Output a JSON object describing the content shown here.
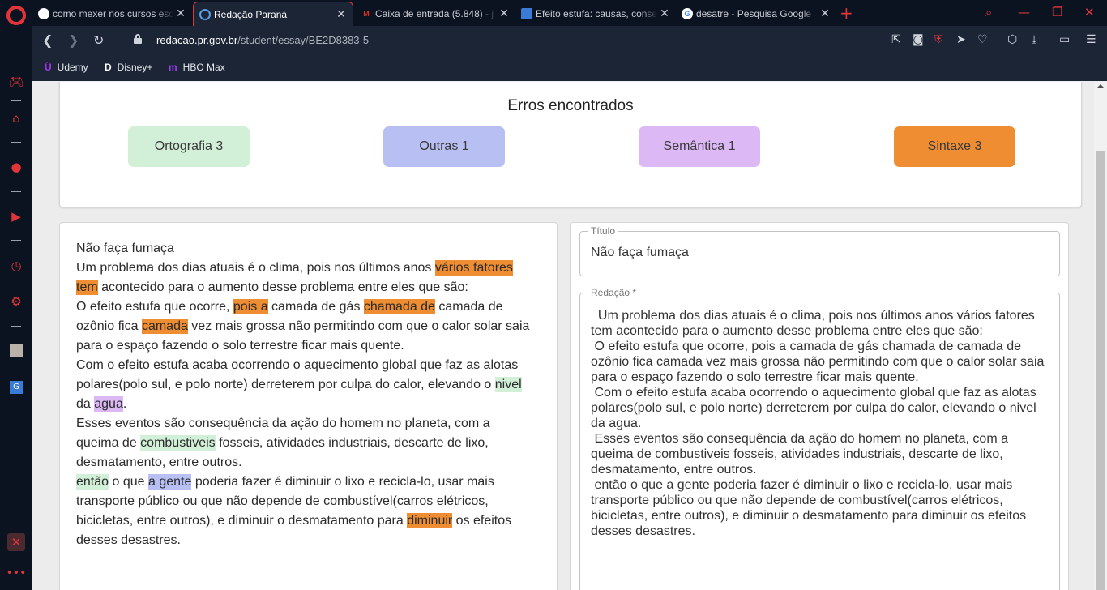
{
  "browser": {
    "tabs": [
      {
        "label": "como mexer nos cursos esc",
        "favicon": "c",
        "favicon_color": "#ffffff",
        "active": false
      },
      {
        "label": "Redação Paraná",
        "favicon": "chat-bubble",
        "favicon_color": "#5aa0e6",
        "active": true
      },
      {
        "label": "Caixa de entrada (5.848) - j",
        "favicon": "M",
        "favicon_color": "#d93025",
        "active": false
      },
      {
        "label": "Efeito estufa: causas, conse",
        "favicon": "earth",
        "favicon_color": "#3a7bd5",
        "active": false
      },
      {
        "label": "desatre - Pesquisa Google",
        "favicon": "G",
        "favicon_color": "#4285f4",
        "active": false
      }
    ],
    "url_domain": "redacao.pr.gov.br",
    "url_path": "/student/essay/BE2D8383-5",
    "bookmarks": [
      {
        "label": "Udemy",
        "icon": "udemy-icon",
        "color": "#a435f0"
      },
      {
        "label": "Disney+",
        "icon": "disney-icon",
        "color": "#ffffff"
      },
      {
        "label": "HBO Max",
        "icon": "hbo-max-icon",
        "color": "#9b41f5"
      }
    ],
    "accent": "#e2353a"
  },
  "errors": {
    "title": "Erros encontrados",
    "chips": [
      {
        "label": "Ortografia 3",
        "color": "#d2f0d8"
      },
      {
        "label": "Outras 1",
        "color": "#b8bff3"
      },
      {
        "label": "Semântica 1",
        "color": "#dcb8f5"
      },
      {
        "label": "Sintaxe 3",
        "color": "#ef8d33"
      }
    ]
  },
  "essay_view": {
    "paragraphs": [
      [
        {
          "t": "Não faça fumaça"
        }
      ],
      [
        {
          "t": "Um problema dos dias atuais é o clima, pois nos últimos anos "
        },
        {
          "t": "vários fatores tem",
          "hl": "orange"
        },
        {
          "t": " acontecido para o aumento desse problema entre eles que são:"
        }
      ],
      [
        {
          "t": "O efeito estufa que ocorre, "
        },
        {
          "t": "pois a",
          "hl": "orange"
        },
        {
          "t": " camada de gás "
        },
        {
          "t": "chamada de",
          "hl": "orange"
        },
        {
          "t": " camada de ozônio fica "
        },
        {
          "t": "camada",
          "hl": "orange"
        },
        {
          "t": " vez mais grossa não permitindo com que o calor solar saia para o espaço fazendo o solo terrestre ficar mais quente."
        }
      ],
      [
        {
          "t": "Com o efeito estufa acaba ocorrendo o aquecimento global que faz as alotas polares(polo sul, e polo norte) derreterem por culpa do calor, elevando o "
        },
        {
          "t": "nivel",
          "hl": "green"
        },
        {
          "t": " da "
        },
        {
          "t": "agua",
          "hl": "purple"
        },
        {
          "t": "."
        }
      ],
      [
        {
          "t": "Esses eventos são consequência da ação do homem no planeta, com a queima de "
        },
        {
          "t": "combustiveis",
          "hl": "green"
        },
        {
          "t": " fosseis, atividades industriais, descarte de lixo, desmatamento, entre outros."
        }
      ],
      [
        {
          "t": "então",
          "hl": "green"
        },
        {
          "t": " o que "
        },
        {
          "t": "a gente",
          "hl": "blue"
        },
        {
          "t": " poderia fazer é diminuir o lixo e recicla-lo, usar mais transporte público ou que não depende de combustível(carros elétricos, bicicletas, entre outros), e diminuir o desmatamento para "
        },
        {
          "t": "diminuir",
          "hl": "orange"
        },
        {
          "t": " os efeitos desses desastres."
        }
      ]
    ]
  },
  "form": {
    "title_label": "Título",
    "title_value": "Não faça fumaça",
    "essay_label": "Redação *",
    "essay_value": "  Um problema dos dias atuais é o clima, pois nos últimos anos vários fatores tem acontecido para o aumento desse problema entre eles que são:\n O efeito estufa que ocorre, pois a camada de gás chamada de camada de ozônio fica camada vez mais grossa não permitindo com que o calor solar saia para o espaço fazendo o solo terrestre ficar mais quente.\n Com o efeito estufa acaba ocorrendo o aquecimento global que faz as alotas polares(polo sul, e polo norte) derreterem por culpa do calor, elevando o nivel da agua.\n Esses eventos são consequência da ação do homem no planeta, com a queima de combustiveis fosseis, atividades industriais, descarte de lixo, desmatamento, entre outros.\n então o que a gente poderia fazer é diminuir o lixo e recicla-lo, usar mais transporte público ou que não depende de combustível(carros elétricos, bicicletas, entre outros), e diminuir o desmatamento para diminuir os efeitos desses desastres."
  }
}
